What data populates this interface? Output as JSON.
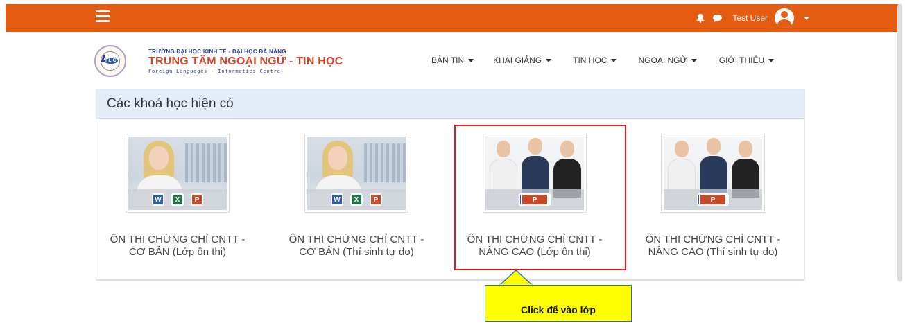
{
  "topbar": {
    "username": "Test User",
    "color": "#e45c12"
  },
  "logo": {
    "line1": "TRƯỜNG ĐẠI HỌC KINH TẾ - ĐẠI HỌC ĐÀ NẴNG",
    "line2": "TRUNG TÂM NGOẠI NGỮ - TIN HỌC",
    "line3": "Foreign Languages - Informatics Centre",
    "badge": "FLIC"
  },
  "nav": {
    "items": [
      {
        "label": "BẢN TIN"
      },
      {
        "label": "KHAI GIẢNG"
      },
      {
        "label": "TIN HỌC"
      },
      {
        "label": "NGOẠI NGỮ"
      },
      {
        "label": "GIỚI THIỆU"
      }
    ]
  },
  "courses": {
    "title": "Các khoá học hiện có",
    "items": [
      {
        "name_line1": "ÔN THI CHỨNG CHỈ CNTT -",
        "name_line2": "CƠ BẢN (Lớp ôn thi)",
        "image": "woman-office"
      },
      {
        "name_line1": "ÔN THI CHỨNG CHỈ CNTT -",
        "name_line2": "CƠ BẢN (Thí sinh tự do)",
        "image": "woman-office"
      },
      {
        "name_line1": "ÔN THI CHỨNG CHỈ CNTT -",
        "name_line2": "NÂNG CAO (Lớp ôn thi)",
        "image": "business-team"
      },
      {
        "name_line1": "ÔN THI CHỨNG CHỈ CNTT -",
        "name_line2": "NÂNG CAO (Thí sinh tự do)",
        "image": "business-team"
      }
    ],
    "icon_letters": [
      "W",
      "X",
      "P"
    ]
  },
  "annotation": {
    "callout_text": "Click để vào lớp",
    "highlight_color": "#e31b1b",
    "callout_color": "#ffff00"
  }
}
